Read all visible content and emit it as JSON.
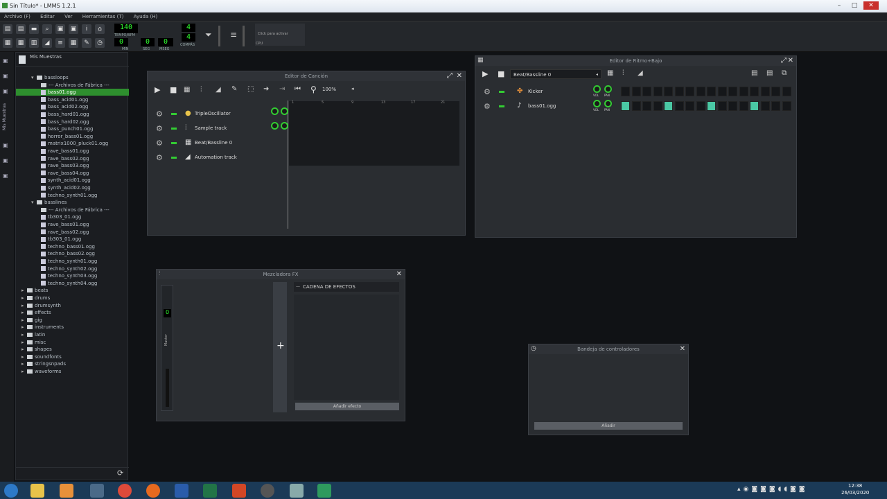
{
  "window": {
    "title": "Sin Título* - LMMS 1.2.1"
  },
  "menu": [
    "Archivo (F)",
    "Editar",
    "Ver",
    "Herramientas (T)",
    "Ayuda (H)"
  ],
  "toolbar": {
    "tempo": "140",
    "tempo_label": "TEMPO/BPM",
    "min": "0",
    "sec": "0",
    "msec": "0",
    "min_label": "MIN",
    "sec_label": "SEG",
    "msec_label": "MSEG",
    "sig_top": "4",
    "sig_bottom": "4",
    "sig_label": "COMPÁS",
    "cpu_hint": "Click para activar",
    "cpu_label": "CPU"
  },
  "browser": {
    "title": "Mis Muestras",
    "items": [
      {
        "t": "bassloops",
        "d": 1,
        "k": "folder",
        "open": true
      },
      {
        "t": "--- Archivos de Fábrica ---",
        "d": 2,
        "k": "folder"
      },
      {
        "t": "bass01.ogg",
        "d": 2,
        "k": "file",
        "sel": true
      },
      {
        "t": "bass_acid01.ogg",
        "d": 2,
        "k": "file"
      },
      {
        "t": "bass_acid02.ogg",
        "d": 2,
        "k": "file"
      },
      {
        "t": "bass_hard01.ogg",
        "d": 2,
        "k": "file"
      },
      {
        "t": "bass_hard02.ogg",
        "d": 2,
        "k": "file"
      },
      {
        "t": "bass_punch01.ogg",
        "d": 2,
        "k": "file"
      },
      {
        "t": "horror_bass01.ogg",
        "d": 2,
        "k": "file"
      },
      {
        "t": "matrix1000_pluck01.ogg",
        "d": 2,
        "k": "file"
      },
      {
        "t": "rave_bass01.ogg",
        "d": 2,
        "k": "file"
      },
      {
        "t": "rave_bass02.ogg",
        "d": 2,
        "k": "file"
      },
      {
        "t": "rave_bass03.ogg",
        "d": 2,
        "k": "file"
      },
      {
        "t": "rave_bass04.ogg",
        "d": 2,
        "k": "file"
      },
      {
        "t": "synth_acid01.ogg",
        "d": 2,
        "k": "file"
      },
      {
        "t": "synth_acid02.ogg",
        "d": 2,
        "k": "file"
      },
      {
        "t": "techno_synth01.ogg",
        "d": 2,
        "k": "file"
      },
      {
        "t": "basslines",
        "d": 1,
        "k": "folder",
        "open": true
      },
      {
        "t": "--- Archivos de Fábrica ---",
        "d": 2,
        "k": "folder"
      },
      {
        "t": "tb303_01.ogg",
        "d": 2,
        "k": "file"
      },
      {
        "t": "rave_bass01.ogg",
        "d": 2,
        "k": "file"
      },
      {
        "t": "rave_bass02.ogg",
        "d": 2,
        "k": "file"
      },
      {
        "t": "tb303_01.ogg",
        "d": 2,
        "k": "file"
      },
      {
        "t": "techno_bass01.ogg",
        "d": 2,
        "k": "file"
      },
      {
        "t": "techno_bass02.ogg",
        "d": 2,
        "k": "file"
      },
      {
        "t": "techno_synth01.ogg",
        "d": 2,
        "k": "file"
      },
      {
        "t": "techno_synth02.ogg",
        "d": 2,
        "k": "file"
      },
      {
        "t": "techno_synth03.ogg",
        "d": 2,
        "k": "file"
      },
      {
        "t": "techno_synth04.ogg",
        "d": 2,
        "k": "file"
      },
      {
        "t": "beats",
        "d": 0,
        "k": "folder"
      },
      {
        "t": "drums",
        "d": 0,
        "k": "folder"
      },
      {
        "t": "drumsynth",
        "d": 0,
        "k": "folder"
      },
      {
        "t": "effects",
        "d": 0,
        "k": "folder"
      },
      {
        "t": "gig",
        "d": 0,
        "k": "folder"
      },
      {
        "t": "instruments",
        "d": 0,
        "k": "folder"
      },
      {
        "t": "latin",
        "d": 0,
        "k": "folder"
      },
      {
        "t": "misc",
        "d": 0,
        "k": "folder"
      },
      {
        "t": "shapes",
        "d": 0,
        "k": "folder"
      },
      {
        "t": "soundfonts",
        "d": 0,
        "k": "folder"
      },
      {
        "t": "stringsnpads",
        "d": 0,
        "k": "folder"
      },
      {
        "t": "waveforms",
        "d": 0,
        "k": "folder"
      }
    ]
  },
  "song_editor": {
    "title": "Editor de Canción",
    "zoom": "100%",
    "tracks": [
      {
        "name": "TripleOscillator",
        "icon": "plugin-icon"
      },
      {
        "name": "Sample track",
        "icon": "waveform-icon"
      },
      {
        "name": "Beat/Bassline 0",
        "icon": "grid-icon"
      },
      {
        "name": "Automation track",
        "icon": "automation-icon"
      }
    ],
    "bars": [
      "1",
      "5",
      "9",
      "13",
      "17",
      "21"
    ]
  },
  "beat_editor": {
    "title": "Editor de Ritmo+Bajo",
    "selector": "Beat/Bassline 0",
    "vol_label": "VOL",
    "pan_label": "PAN",
    "tracks": [
      {
        "name": "Kicker",
        "steps": [
          0,
          0,
          0,
          0,
          0,
          0,
          0,
          0,
          0,
          0,
          0,
          0,
          0,
          0,
          0,
          0
        ]
      },
      {
        "name": "bass01.ogg",
        "steps": [
          1,
          0,
          0,
          0,
          1,
          0,
          0,
          0,
          1,
          0,
          0,
          0,
          1,
          0,
          0,
          0
        ]
      }
    ]
  },
  "fx_mixer": {
    "title": "Mezcladora FX",
    "chain_label": "CADENA DE EFECTOS",
    "add_effect": "Añadir efecto",
    "master": "Master",
    "channel": "0",
    "add_channel": "+"
  },
  "controller_rack": {
    "title": "Bandeja de controladores",
    "add": "Añadir"
  },
  "taskbar": {
    "time": "12:38",
    "date": "26/03/2020"
  }
}
